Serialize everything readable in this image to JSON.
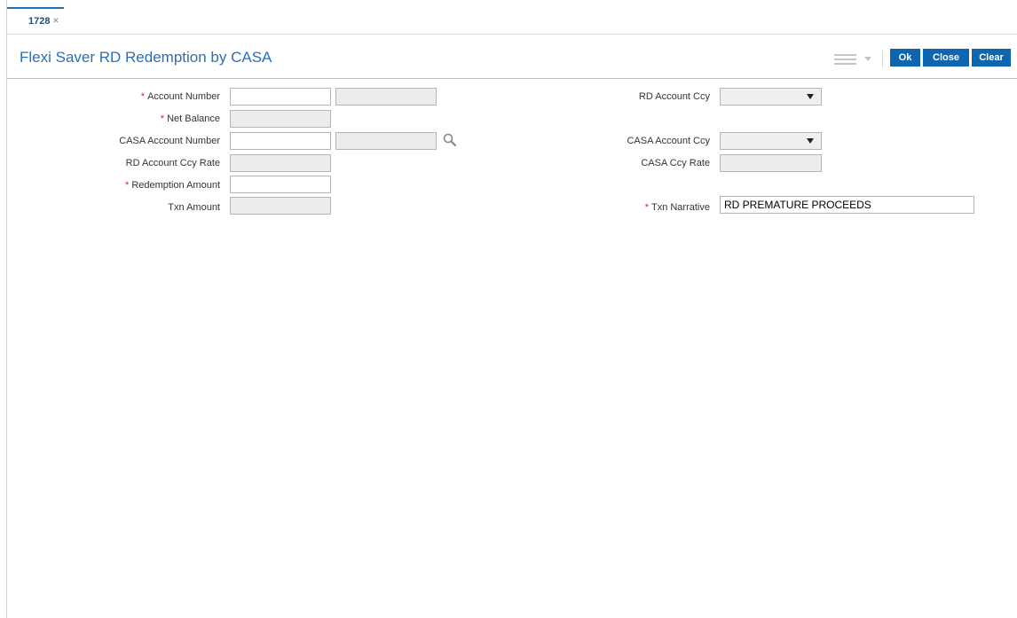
{
  "tab": {
    "label": "1728",
    "close": "×"
  },
  "page": {
    "title": "Flexi Saver RD Redemption by CASA"
  },
  "toolbar": {
    "ok": "Ok",
    "close": "Close",
    "clear": "Clear"
  },
  "icons": {
    "menu": "hamburger-menu-icon",
    "search": "magnifier-search-icon"
  },
  "colors": {
    "accent": "#0e65b0",
    "title": "#2a70b8",
    "required": "#d9262a"
  },
  "form": {
    "required_mark": "*",
    "account_number": {
      "label": "Account Number",
      "value": "",
      "name_value": ""
    },
    "net_balance": {
      "label": "Net Balance",
      "value": ""
    },
    "casa_account_number": {
      "label": "CASA Account Number",
      "value": "",
      "name_value": ""
    },
    "rd_account_ccy_rate": {
      "label": "RD Account Ccy Rate",
      "value": ""
    },
    "redemption_amount": {
      "label": "Redemption Amount",
      "value": ""
    },
    "txn_amount": {
      "label": "Txn Amount",
      "value": ""
    },
    "rd_account_ccy": {
      "label": "RD Account Ccy",
      "value": ""
    },
    "casa_account_ccy": {
      "label": "CASA Account Ccy",
      "value": ""
    },
    "casa_ccy_rate": {
      "label": "CASA Ccy Rate",
      "value": ""
    },
    "txn_narrative": {
      "label": "Txn Narrative",
      "value": "RD PREMATURE PROCEEDS"
    }
  }
}
